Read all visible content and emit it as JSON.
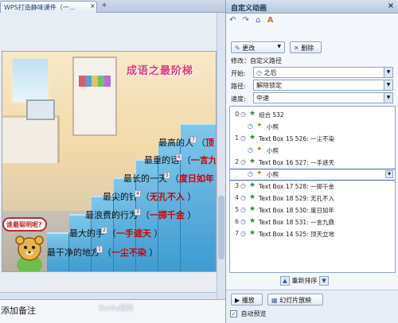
{
  "document_tab": {
    "title": "WPS打造静味课件（一...",
    "close_glyph": "×",
    "new_tab_glyph": "+"
  },
  "slide": {
    "title": "成语之最阶梯",
    "bubble_text": "谁最聪明呢?",
    "rows": [
      {
        "prefix": "最高的人",
        "badge": "7",
        "answer": "顶",
        "suffix": ""
      },
      {
        "prefix": "最重的话",
        "badge": "6",
        "answer": "一言九",
        "suffix": ""
      },
      {
        "prefix": "最长的一天",
        "badge": "5",
        "answer": "度日如年",
        "suffix": ""
      },
      {
        "prefix": "最尖的针",
        "badge": "4",
        "answer": "无孔不入",
        "suffix": "）"
      },
      {
        "prefix": "最浪费的行为",
        "badge": "3",
        "answer": "一掷千金",
        "suffix": "）"
      },
      {
        "prefix": "最大的手",
        "badge": "2",
        "answer": "一手遮天",
        "suffix": "）"
      },
      {
        "prefix": "最干净的地方",
        "badge": "1",
        "answer": "一尘不染",
        "suffix": "）"
      }
    ]
  },
  "notes": {
    "placeholder": "添加备注"
  },
  "pane": {
    "title": "自定义动画",
    "close_glyph": "×",
    "nav_icons": [
      "back-icon",
      "forward-icon",
      "home-icon",
      "font-icon"
    ],
    "change_button": "更改",
    "delete_button": "删除",
    "modify_label": "修改：自定义路径",
    "start_label": "开始:",
    "start_value": "之后",
    "path_label": "路径:",
    "path_value": "解除锁定",
    "speed_label": "速度:",
    "speed_value": "中速",
    "effects": [
      {
        "num": "0",
        "label": "组合 532",
        "indent": false,
        "selected": false
      },
      {
        "num": "",
        "label": "小熊",
        "indent": true,
        "selected": false
      },
      {
        "num": "1",
        "label": "Text Box 15 526: 一尘不染",
        "indent": false,
        "selected": false
      },
      {
        "num": "",
        "label": "小熊",
        "indent": true,
        "selected": false
      },
      {
        "num": "2",
        "label": "Text Box 16 527: 一手遮天",
        "indent": false,
        "selected": false
      },
      {
        "num": "",
        "label": "小熊",
        "indent": true,
        "selected": true
      },
      {
        "num": "3",
        "label": "Text Box 17 528: 一掷千金",
        "indent": false,
        "selected": false
      },
      {
        "num": "4",
        "label": "Text Box 18 529: 无孔不入",
        "indent": false,
        "selected": false
      },
      {
        "num": "5",
        "label": "Text Box 18 530: 度日如年",
        "indent": false,
        "selected": false
      },
      {
        "num": "6",
        "label": "Text Box 18 531: 一言九鼎",
        "indent": false,
        "selected": false
      },
      {
        "num": "7",
        "label": "Text Box 14 525: 顶天立地",
        "indent": false,
        "selected": false
      }
    ],
    "reorder_label": "重新排序",
    "play_button": "播放",
    "slideshow_button": "幻灯片放映",
    "autopreview_label": "自动预览",
    "autopreview_checked": true
  },
  "watermark": "Baidu经验"
}
